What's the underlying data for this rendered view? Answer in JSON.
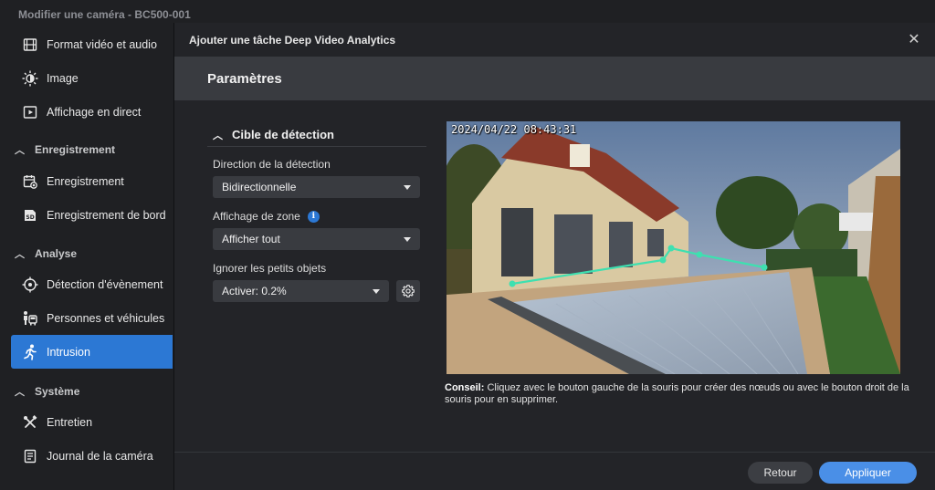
{
  "app": {
    "title": "Modifier une caméra - BC500-001"
  },
  "sidebar": {
    "items": [
      {
        "label": "Format vidéo et audio",
        "icon": "film-icon"
      },
      {
        "label": "Image",
        "icon": "brightness-icon"
      },
      {
        "label": "Affichage en direct",
        "icon": "play-square-icon"
      }
    ],
    "sections": [
      {
        "label": "Enregistrement",
        "items": [
          {
            "label": "Enregistrement",
            "icon": "calendar-record-icon"
          },
          {
            "label": "Enregistrement de bord",
            "icon": "sd-card-icon"
          }
        ]
      },
      {
        "label": "Analyse",
        "items": [
          {
            "label": "Détection d'évènement",
            "icon": "crosshair-icon"
          },
          {
            "label": "Personnes et véhicules",
            "icon": "person-vehicle-icon"
          },
          {
            "label": "Intrusion",
            "icon": "running-person-icon"
          }
        ]
      },
      {
        "label": "Système",
        "items": [
          {
            "label": "Entretien",
            "icon": "tools-icon"
          },
          {
            "label": "Journal de la caméra",
            "icon": "log-icon"
          }
        ]
      }
    ]
  },
  "modal": {
    "title": "Ajouter une tâche Deep Video Analytics",
    "section_title": "Paramètres",
    "panel_title": "Cible de détection",
    "direction": {
      "label": "Direction de la détection",
      "value": "Bidirectionnelle"
    },
    "zone_display": {
      "label": "Affichage de zone",
      "value": "Afficher tout",
      "info": "i"
    },
    "small_objects": {
      "label": "Ignorer les petits objets",
      "value": "Activer: 0.2%"
    },
    "preview": {
      "timestamp": "2024/04/22 08:43:31"
    },
    "tip": {
      "prefix": "Conseil:",
      "text": " Cliquez avec le bouton gauche de la souris pour créer des nœuds ou avec le bouton droit de la souris pour en supprimer."
    },
    "buttons": {
      "back": "Retour",
      "apply": "Appliquer"
    }
  },
  "colors": {
    "accent": "#2c78d4",
    "apply": "#4a8fe7",
    "line": "#3ee0b0"
  }
}
